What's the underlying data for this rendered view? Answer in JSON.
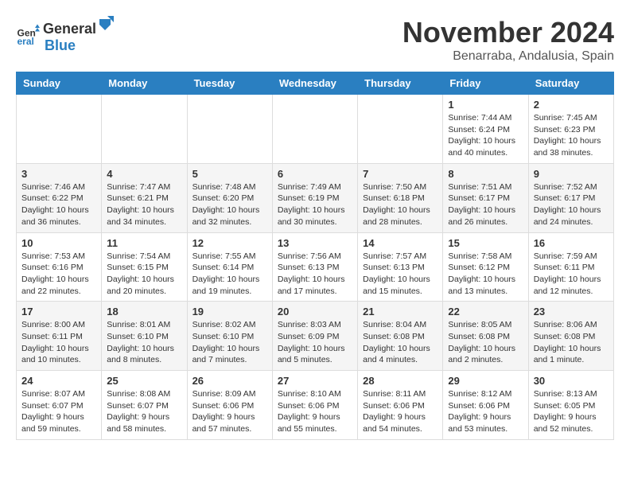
{
  "header": {
    "logo_general": "General",
    "logo_blue": "Blue",
    "month_title": "November 2024",
    "location": "Benarraba, Andalusia, Spain"
  },
  "days_of_week": [
    "Sunday",
    "Monday",
    "Tuesday",
    "Wednesday",
    "Thursday",
    "Friday",
    "Saturday"
  ],
  "weeks": [
    [
      {
        "day": "",
        "info": ""
      },
      {
        "day": "",
        "info": ""
      },
      {
        "day": "",
        "info": ""
      },
      {
        "day": "",
        "info": ""
      },
      {
        "day": "",
        "info": ""
      },
      {
        "day": "1",
        "info": "Sunrise: 7:44 AM\nSunset: 6:24 PM\nDaylight: 10 hours and 40 minutes."
      },
      {
        "day": "2",
        "info": "Sunrise: 7:45 AM\nSunset: 6:23 PM\nDaylight: 10 hours and 38 minutes."
      }
    ],
    [
      {
        "day": "3",
        "info": "Sunrise: 7:46 AM\nSunset: 6:22 PM\nDaylight: 10 hours and 36 minutes."
      },
      {
        "day": "4",
        "info": "Sunrise: 7:47 AM\nSunset: 6:21 PM\nDaylight: 10 hours and 34 minutes."
      },
      {
        "day": "5",
        "info": "Sunrise: 7:48 AM\nSunset: 6:20 PM\nDaylight: 10 hours and 32 minutes."
      },
      {
        "day": "6",
        "info": "Sunrise: 7:49 AM\nSunset: 6:19 PM\nDaylight: 10 hours and 30 minutes."
      },
      {
        "day": "7",
        "info": "Sunrise: 7:50 AM\nSunset: 6:18 PM\nDaylight: 10 hours and 28 minutes."
      },
      {
        "day": "8",
        "info": "Sunrise: 7:51 AM\nSunset: 6:17 PM\nDaylight: 10 hours and 26 minutes."
      },
      {
        "day": "9",
        "info": "Sunrise: 7:52 AM\nSunset: 6:17 PM\nDaylight: 10 hours and 24 minutes."
      }
    ],
    [
      {
        "day": "10",
        "info": "Sunrise: 7:53 AM\nSunset: 6:16 PM\nDaylight: 10 hours and 22 minutes."
      },
      {
        "day": "11",
        "info": "Sunrise: 7:54 AM\nSunset: 6:15 PM\nDaylight: 10 hours and 20 minutes."
      },
      {
        "day": "12",
        "info": "Sunrise: 7:55 AM\nSunset: 6:14 PM\nDaylight: 10 hours and 19 minutes."
      },
      {
        "day": "13",
        "info": "Sunrise: 7:56 AM\nSunset: 6:13 PM\nDaylight: 10 hours and 17 minutes."
      },
      {
        "day": "14",
        "info": "Sunrise: 7:57 AM\nSunset: 6:13 PM\nDaylight: 10 hours and 15 minutes."
      },
      {
        "day": "15",
        "info": "Sunrise: 7:58 AM\nSunset: 6:12 PM\nDaylight: 10 hours and 13 minutes."
      },
      {
        "day": "16",
        "info": "Sunrise: 7:59 AM\nSunset: 6:11 PM\nDaylight: 10 hours and 12 minutes."
      }
    ],
    [
      {
        "day": "17",
        "info": "Sunrise: 8:00 AM\nSunset: 6:11 PM\nDaylight: 10 hours and 10 minutes."
      },
      {
        "day": "18",
        "info": "Sunrise: 8:01 AM\nSunset: 6:10 PM\nDaylight: 10 hours and 8 minutes."
      },
      {
        "day": "19",
        "info": "Sunrise: 8:02 AM\nSunset: 6:10 PM\nDaylight: 10 hours and 7 minutes."
      },
      {
        "day": "20",
        "info": "Sunrise: 8:03 AM\nSunset: 6:09 PM\nDaylight: 10 hours and 5 minutes."
      },
      {
        "day": "21",
        "info": "Sunrise: 8:04 AM\nSunset: 6:08 PM\nDaylight: 10 hours and 4 minutes."
      },
      {
        "day": "22",
        "info": "Sunrise: 8:05 AM\nSunset: 6:08 PM\nDaylight: 10 hours and 2 minutes."
      },
      {
        "day": "23",
        "info": "Sunrise: 8:06 AM\nSunset: 6:08 PM\nDaylight: 10 hours and 1 minute."
      }
    ],
    [
      {
        "day": "24",
        "info": "Sunrise: 8:07 AM\nSunset: 6:07 PM\nDaylight: 9 hours and 59 minutes."
      },
      {
        "day": "25",
        "info": "Sunrise: 8:08 AM\nSunset: 6:07 PM\nDaylight: 9 hours and 58 minutes."
      },
      {
        "day": "26",
        "info": "Sunrise: 8:09 AM\nSunset: 6:06 PM\nDaylight: 9 hours and 57 minutes."
      },
      {
        "day": "27",
        "info": "Sunrise: 8:10 AM\nSunset: 6:06 PM\nDaylight: 9 hours and 55 minutes."
      },
      {
        "day": "28",
        "info": "Sunrise: 8:11 AM\nSunset: 6:06 PM\nDaylight: 9 hours and 54 minutes."
      },
      {
        "day": "29",
        "info": "Sunrise: 8:12 AM\nSunset: 6:06 PM\nDaylight: 9 hours and 53 minutes."
      },
      {
        "day": "30",
        "info": "Sunrise: 8:13 AM\nSunset: 6:05 PM\nDaylight: 9 hours and 52 minutes."
      }
    ]
  ]
}
